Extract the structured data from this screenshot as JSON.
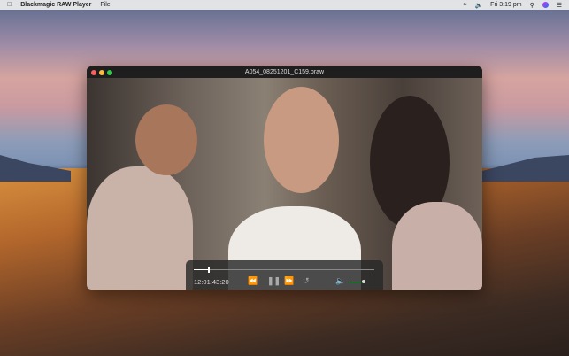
{
  "menubar": {
    "app_name": "Blackmagic RAW Player",
    "menus": [
      "File"
    ],
    "clock": "Fri 3:19 pm"
  },
  "window": {
    "title": "A054_08251201_C159.braw"
  },
  "player": {
    "timecode": "12:01:43:20",
    "progress_percent": 8,
    "volume_percent": 55,
    "accent_color": "#2ecc40"
  }
}
